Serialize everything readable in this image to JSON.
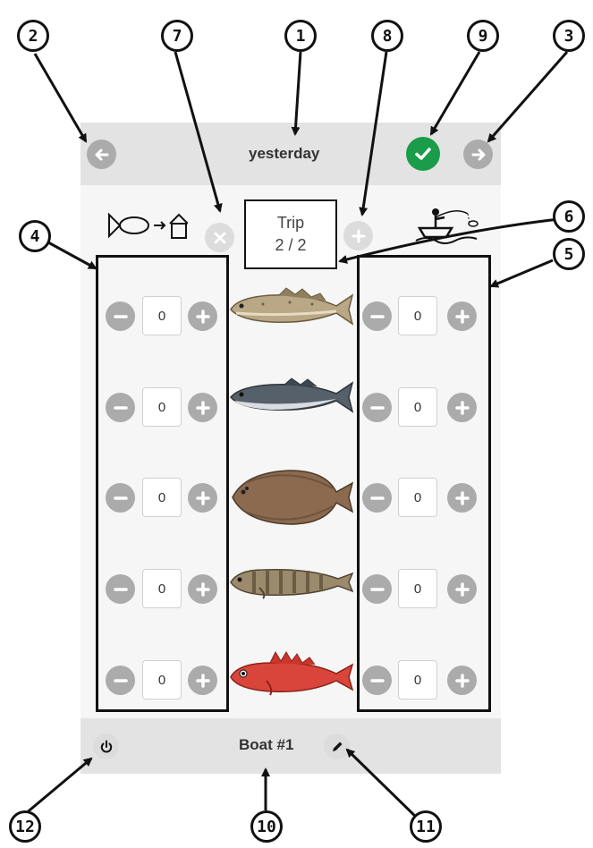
{
  "header": {
    "date_label": "yesterday"
  },
  "trip": {
    "label": "Trip",
    "counter": "2 / 2"
  },
  "footer": {
    "boat_name": "Boat #1"
  },
  "counters": {
    "left": [
      "0",
      "0",
      "0",
      "0",
      "0"
    ],
    "right": [
      "0",
      "0",
      "0",
      "0",
      "0"
    ]
  },
  "species_icons": [
    "cod-icon",
    "saithe-icon",
    "flatfish-icon",
    "tusk-icon",
    "redfish-icon"
  ],
  "callouts": [
    "1",
    "2",
    "3",
    "4",
    "5",
    "6",
    "7",
    "8",
    "9",
    "10",
    "11",
    "12"
  ],
  "colors": {
    "confirm_green": "#1a9c4a",
    "button_gray": "#ababab",
    "bar_gray": "#e3e3e3"
  }
}
